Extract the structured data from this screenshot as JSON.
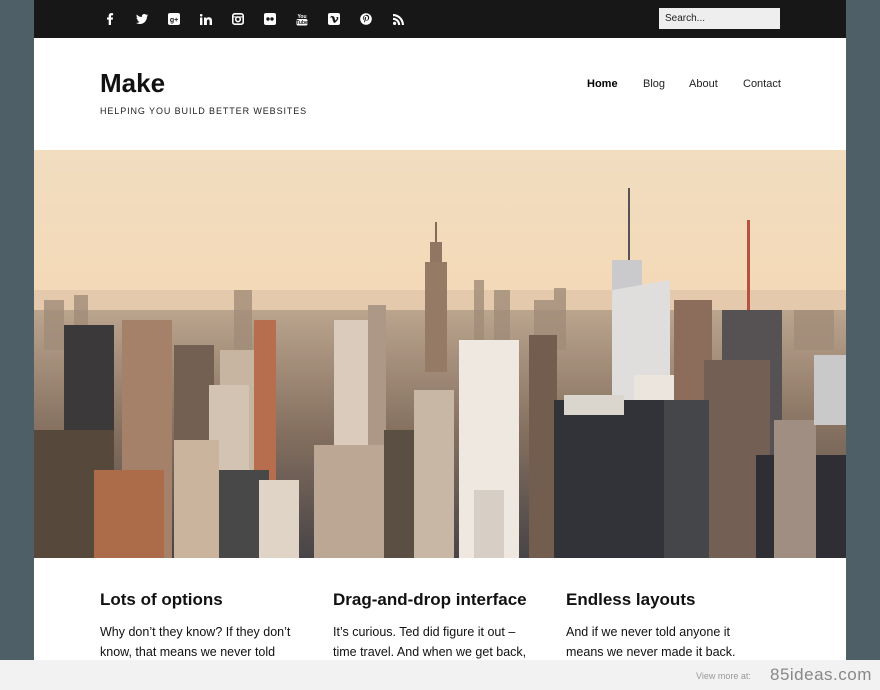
{
  "topbar": {
    "social": [
      {
        "name": "facebook-icon",
        "glyph": "f"
      },
      {
        "name": "twitter-icon",
        "glyph": "t"
      },
      {
        "name": "google-plus-icon",
        "glyph": "g+"
      },
      {
        "name": "linkedin-icon",
        "glyph": "in"
      },
      {
        "name": "instagram-icon",
        "glyph": "ig"
      },
      {
        "name": "flickr-icon",
        "glyph": "fl"
      },
      {
        "name": "youtube-icon",
        "glyph": "yt"
      },
      {
        "name": "vimeo-icon",
        "glyph": "v"
      },
      {
        "name": "pinterest-icon",
        "glyph": "p"
      },
      {
        "name": "rss-icon",
        "glyph": "rss"
      }
    ],
    "search_placeholder": "Search..."
  },
  "header": {
    "title": "Make",
    "tagline": "HELPING YOU BUILD BETTER WEBSITES"
  },
  "nav": {
    "items": [
      {
        "label": "Home",
        "active": true
      },
      {
        "label": "Blog",
        "active": false
      },
      {
        "label": "About",
        "active": false
      },
      {
        "label": "Contact",
        "active": false
      }
    ]
  },
  "hero": {
    "description": "city-skyline-photo"
  },
  "features": [
    {
      "title": "Lots of options",
      "text": "Why don’t they know? If they don’t know, that means we never told"
    },
    {
      "title": "Drag-and-drop interface",
      "text": "It’s curious. Ted did figure it out – time travel. And when we get back,"
    },
    {
      "title": "Endless layouts",
      "text": "And if we never told anyone it means we never made it back. Hence we die"
    }
  ],
  "footer": {
    "view_more": "View more at:",
    "brand": "85ideas.com"
  },
  "colors": {
    "outer_bg": "#4f5f68",
    "topbar_bg": "#171717",
    "page_bg": "#ffffff"
  }
}
